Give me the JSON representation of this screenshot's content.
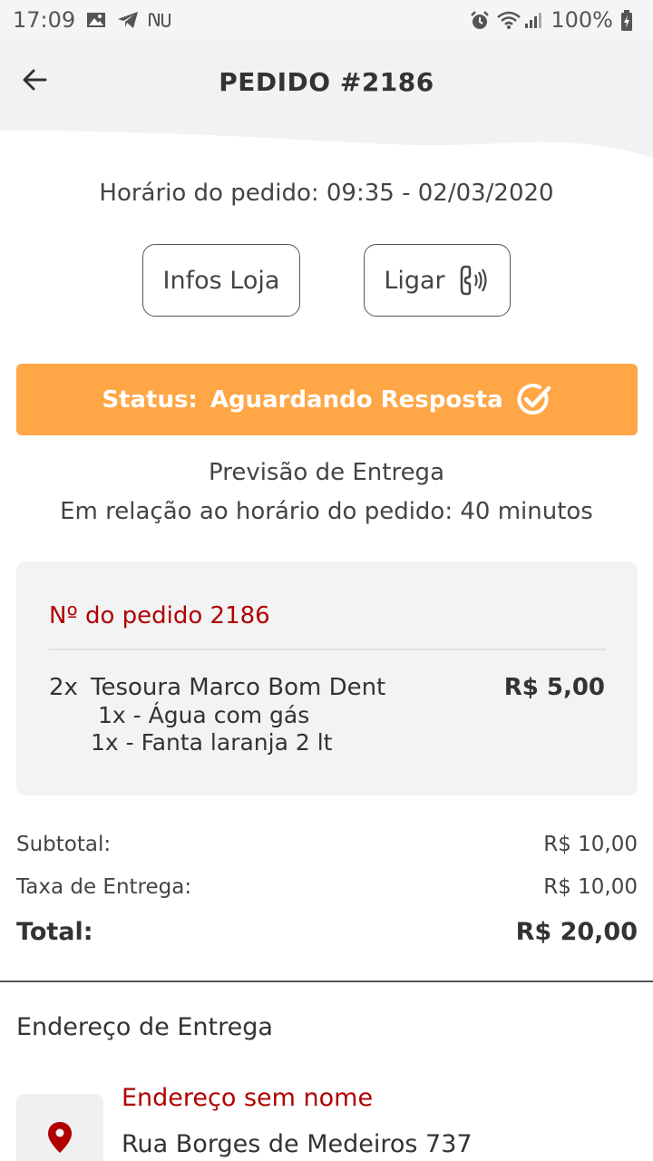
{
  "status_bar": {
    "time": "17:09",
    "battery": "100%",
    "left_icons": [
      "image-icon",
      "telegram-icon",
      "nubank-icon"
    ],
    "right_icons": [
      "alarm-icon",
      "wifi-icon",
      "signal-icon",
      "battery-charging-icon"
    ]
  },
  "header": {
    "title": "PEDIDO #2186",
    "back_icon": "arrow-left-icon"
  },
  "order_time": "Horário do pedido: 09:35 - 02/03/2020",
  "actions": {
    "infos_label": "Infos Loja",
    "call_label": "Ligar",
    "call_icon": "phone-ringing-icon"
  },
  "status": {
    "label": "Status:",
    "value": "Aguardando Resposta",
    "icon": "check-circle-icon",
    "color": "#ffa646"
  },
  "forecast": {
    "title": "Previsão de Entrega",
    "detail": "Em relação ao horário do pedido: 40 minutos"
  },
  "order": {
    "number_label": "Nº do pedido 2186",
    "items": [
      {
        "qty": "2x",
        "name": "Tesoura Marco Bom Dent",
        "price": "R$ 5,00",
        "options": [
          "1x - Água com gás",
          "1x - Fanta laranja 2 lt"
        ]
      }
    ]
  },
  "summary": {
    "subtotal_label": "Subtotal:",
    "subtotal_value": "R$ 10,00",
    "fee_label": "Taxa de Entrega:",
    "fee_value": "R$ 10,00",
    "total_label": "Total:",
    "total_value": "R$ 20,00"
  },
  "address": {
    "section_title": "Endereço de Entrega",
    "name": "Endereço sem nome",
    "street": "Rua Borges de Medeiros 737",
    "icon": "map-pin-icon",
    "accent_color": "#b00000"
  }
}
